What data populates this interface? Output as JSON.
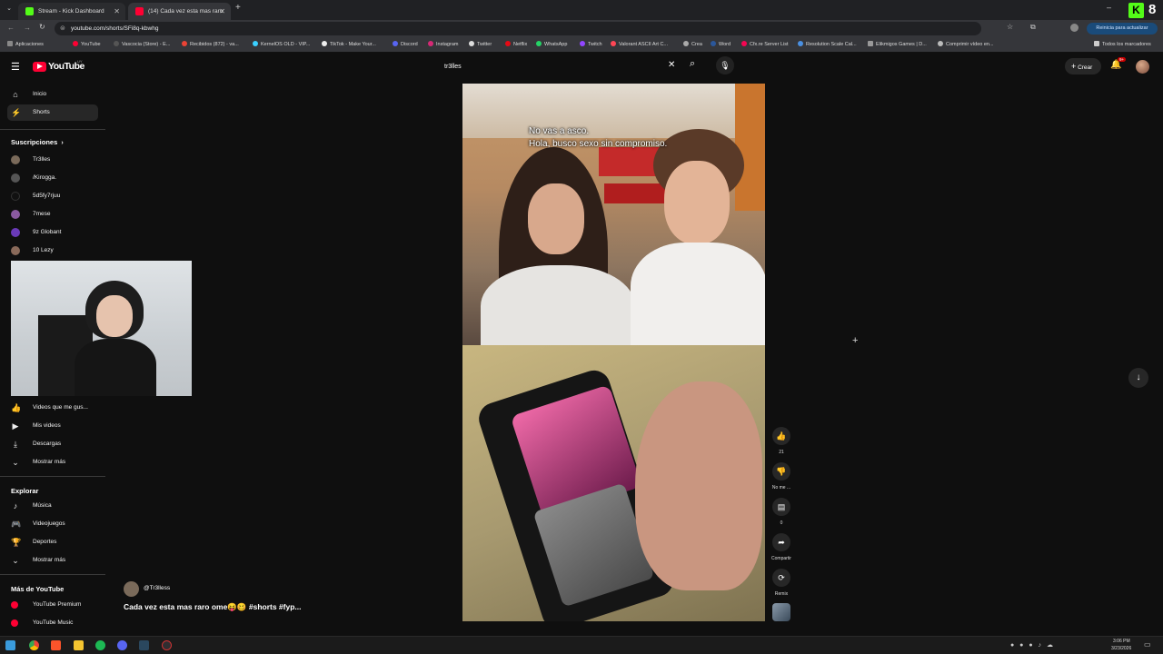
{
  "browser": {
    "tabs": [
      {
        "title": "Stream - Kick Dashboard",
        "color": "#53fc18"
      },
      {
        "title": "(14) Cada vez esta mas raro",
        "color": "#ff0033"
      }
    ],
    "url": "youtube.com/shorts/SFi8q-kbwhg",
    "update_button": "Reinicia para actualizar",
    "bookmarks": [
      "Aplicaciones",
      "YouTube",
      "Vascocia (Store) - E...",
      "Recibidos (872) - va...",
      "KernelOS OLD - VIP...",
      "TikTok - Make Your...",
      "Discord",
      "Instagram",
      "Twitter",
      "Netflix",
      "WhatsApp",
      "Twitch",
      "Valorant ASCII Art C...",
      "Crea",
      "Word",
      "Cfx.re Server List",
      "Resolution Scale Cal...",
      "Elikmigos Games | D...",
      "Comprimir vídeo en..."
    ],
    "all_bookmarks": "Todos los marcadores",
    "kick_overlay": "8"
  },
  "youtube": {
    "logo": "YouTube",
    "logo_country": "UY",
    "search_value": "tr3lles",
    "create_label": "Crear",
    "notif_count": "9+"
  },
  "sidebar": {
    "main": [
      {
        "label": "Inicio",
        "icon": "home-icon"
      },
      {
        "label": "Shorts",
        "icon": "shorts-icon"
      }
    ],
    "subs_title": "Suscripciones",
    "subs": [
      {
        "label": "Tr3lles",
        "color": "#7a6a5a"
      },
      {
        "label": "/Kirogga.",
        "color": "#555"
      },
      {
        "label": "5d5fy7rjuu",
        "color": "#111"
      },
      {
        "label": "7mese",
        "color": "#8a5aa0"
      },
      {
        "label": "9z Globant",
        "color": "#6a3ab8"
      },
      {
        "label": "10 Lezy",
        "color": "#8a6a5a"
      }
    ],
    "you": [
      {
        "label": "Videos que me gus...",
        "icon": "thumbs-up-icon"
      },
      {
        "label": "Mis videos",
        "icon": "play-square-icon"
      },
      {
        "label": "Descargas",
        "icon": "download-icon"
      },
      {
        "label": "Mostrar más",
        "icon": "chevron-down-icon"
      }
    ],
    "explore_title": "Explorar",
    "explore": [
      {
        "label": "Música",
        "icon": "music-icon"
      },
      {
        "label": "Videojuegos",
        "icon": "gamepad-icon"
      },
      {
        "label": "Deportes",
        "icon": "trophy-icon"
      },
      {
        "label": "Mostrar más",
        "icon": "chevron-down-icon"
      }
    ],
    "more_title": "Más de YouTube",
    "more": [
      {
        "label": "YouTube Premium",
        "color": "#ff0033"
      },
      {
        "label": "YouTube Music",
        "color": "#ff0033"
      }
    ]
  },
  "short": {
    "caption_line1": "No vas a asco.",
    "caption_line2": "Hola, busco sexo sin compromiso.",
    "channel": "@Tr3lless",
    "title": "Cada vez esta mas raro ome😝🥴 #shorts #fyp...",
    "like_count": "21",
    "dislike_label": "No me ...",
    "comment_count": "0",
    "share_label": "Compartir",
    "remix_label": "Remix"
  },
  "system": {
    "time": "3:06 PM",
    "date": "3/23/2026"
  }
}
